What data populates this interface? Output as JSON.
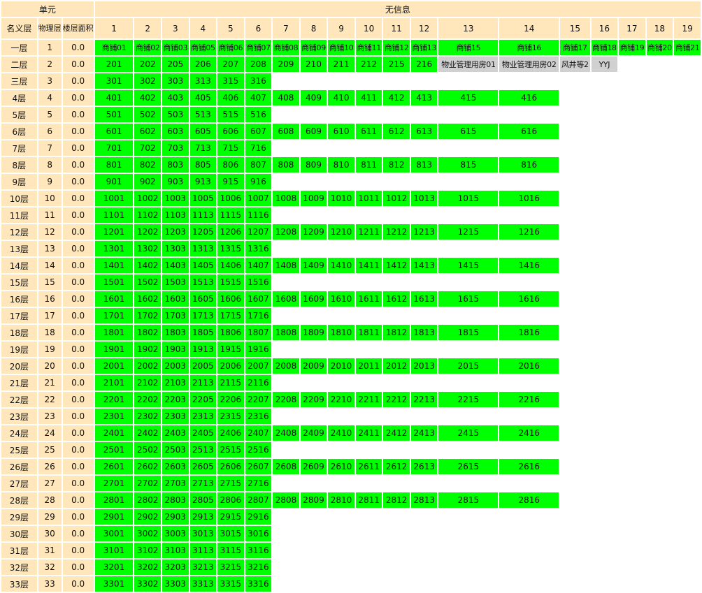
{
  "header": {
    "unit_label": "单元",
    "info_label": "无信息",
    "col_nominal": "名义层",
    "col_physical": "物理层",
    "col_area": "楼层面积",
    "columns": [
      "1",
      "2",
      "3",
      "4",
      "5",
      "6",
      "7",
      "8",
      "9",
      "10",
      "11",
      "12",
      "13",
      "14",
      "15",
      "16",
      "17",
      "18",
      "19"
    ]
  },
  "colors": {
    "header_bg": "#ffe6bb",
    "sold_green": "#00ff00",
    "other_gray": "#d0d0d0"
  },
  "floors": [
    {
      "name": "一层",
      "phys": "1",
      "area": "0.0",
      "rooms": [
        "商铺01",
        "商铺02",
        "商铺03",
        "商铺05",
        "商铺06",
        "商铺07",
        "商铺08",
        "商铺09",
        "商铺10",
        "商铺11",
        "商铺12",
        "商铺13",
        "商铺15",
        "商铺16",
        "商铺17",
        "商铺18",
        "商铺19",
        "商铺20",
        "商铺21"
      ]
    },
    {
      "name": "二层",
      "phys": "2",
      "area": "0.0",
      "rooms": [
        "201",
        "202",
        "205",
        "206",
        "207",
        "208",
        "209",
        "210",
        "211",
        "212",
        "215",
        "216",
        "物业管理用房01",
        "物业管理用房02",
        "风井等2",
        "YYJ"
      ]
    },
    {
      "name": "三层",
      "phys": "3",
      "area": "0.0",
      "rooms": [
        "301",
        "302",
        "303",
        "313",
        "315",
        "316"
      ]
    },
    {
      "name": "4层",
      "phys": "4",
      "area": "0.0",
      "rooms": [
        "401",
        "402",
        "403",
        "405",
        "406",
        "407",
        "408",
        "409",
        "410",
        "411",
        "412",
        "413",
        "415",
        "416"
      ]
    },
    {
      "name": "5层",
      "phys": "5",
      "area": "0.0",
      "rooms": [
        "501",
        "502",
        "503",
        "513",
        "515",
        "516"
      ]
    },
    {
      "name": "6层",
      "phys": "6",
      "area": "0.0",
      "rooms": [
        "601",
        "602",
        "603",
        "605",
        "606",
        "607",
        "608",
        "609",
        "610",
        "611",
        "612",
        "613",
        "615",
        "616"
      ]
    },
    {
      "name": "7层",
      "phys": "7",
      "area": "0.0",
      "rooms": [
        "701",
        "702",
        "703",
        "713",
        "715",
        "716"
      ]
    },
    {
      "name": "8层",
      "phys": "8",
      "area": "0.0",
      "rooms": [
        "801",
        "802",
        "803",
        "805",
        "806",
        "807",
        "808",
        "809",
        "810",
        "811",
        "812",
        "813",
        "815",
        "816"
      ]
    },
    {
      "name": "9层",
      "phys": "9",
      "area": "0.0",
      "rooms": [
        "901",
        "902",
        "903",
        "913",
        "915",
        "916"
      ]
    },
    {
      "name": "10层",
      "phys": "10",
      "area": "0.0",
      "rooms": [
        "1001",
        "1002",
        "1003",
        "1005",
        "1006",
        "1007",
        "1008",
        "1009",
        "1010",
        "1011",
        "1012",
        "1013",
        "1015",
        "1016"
      ]
    },
    {
      "name": "11层",
      "phys": "11",
      "area": "0.0",
      "rooms": [
        "1101",
        "1102",
        "1103",
        "1113",
        "1115",
        "1116"
      ]
    },
    {
      "name": "12层",
      "phys": "12",
      "area": "0.0",
      "rooms": [
        "1201",
        "1202",
        "1203",
        "1205",
        "1206",
        "1207",
        "1208",
        "1209",
        "1210",
        "1211",
        "1212",
        "1213",
        "1215",
        "1216"
      ]
    },
    {
      "name": "13层",
      "phys": "13",
      "area": "0.0",
      "rooms": [
        "1301",
        "1302",
        "1303",
        "1313",
        "1315",
        "1316"
      ]
    },
    {
      "name": "14层",
      "phys": "14",
      "area": "0.0",
      "rooms": [
        "1401",
        "1402",
        "1403",
        "1405",
        "1406",
        "1407",
        "1408",
        "1409",
        "1410",
        "1411",
        "1412",
        "1413",
        "1415",
        "1416"
      ]
    },
    {
      "name": "15层",
      "phys": "15",
      "area": "0.0",
      "rooms": [
        "1501",
        "1502",
        "1503",
        "1513",
        "1515",
        "1516"
      ]
    },
    {
      "name": "16层",
      "phys": "16",
      "area": "0.0",
      "rooms": [
        "1601",
        "1602",
        "1603",
        "1605",
        "1606",
        "1607",
        "1608",
        "1609",
        "1610",
        "1611",
        "1612",
        "1613",
        "1615",
        "1616"
      ]
    },
    {
      "name": "17层",
      "phys": "17",
      "area": "0.0",
      "rooms": [
        "1701",
        "1702",
        "1703",
        "1713",
        "1715",
        "1716"
      ]
    },
    {
      "name": "18层",
      "phys": "18",
      "area": "0.0",
      "rooms": [
        "1801",
        "1802",
        "1803",
        "1805",
        "1806",
        "1807",
        "1808",
        "1809",
        "1810",
        "1811",
        "1812",
        "1813",
        "1815",
        "1816"
      ]
    },
    {
      "name": "19层",
      "phys": "19",
      "area": "0.0",
      "rooms": [
        "1901",
        "1902",
        "1903",
        "1913",
        "1915",
        "1916"
      ]
    },
    {
      "name": "20层",
      "phys": "20",
      "area": "0.0",
      "rooms": [
        "2001",
        "2002",
        "2003",
        "2005",
        "2006",
        "2007",
        "2008",
        "2009",
        "2010",
        "2011",
        "2012",
        "2013",
        "2015",
        "2016"
      ]
    },
    {
      "name": "21层",
      "phys": "21",
      "area": "0.0",
      "rooms": [
        "2101",
        "2102",
        "2103",
        "2113",
        "2115",
        "2116"
      ]
    },
    {
      "name": "22层",
      "phys": "22",
      "area": "0.0",
      "rooms": [
        "2201",
        "2202",
        "2203",
        "2205",
        "2206",
        "2207",
        "2208",
        "2209",
        "2210",
        "2211",
        "2212",
        "2213",
        "2215",
        "2216"
      ]
    },
    {
      "name": "23层",
      "phys": "23",
      "area": "0.0",
      "rooms": [
        "2301",
        "2302",
        "2303",
        "2313",
        "2315",
        "2316"
      ]
    },
    {
      "name": "24层",
      "phys": "24",
      "area": "0.0",
      "rooms": [
        "2401",
        "2402",
        "2403",
        "2405",
        "2406",
        "2407",
        "2408",
        "2409",
        "2410",
        "2411",
        "2412",
        "2413",
        "2415",
        "2416"
      ]
    },
    {
      "name": "25层",
      "phys": "25",
      "area": "0.0",
      "rooms": [
        "2501",
        "2502",
        "2503",
        "2513",
        "2515",
        "2516"
      ]
    },
    {
      "name": "26层",
      "phys": "26",
      "area": "0.0",
      "rooms": [
        "2601",
        "2602",
        "2603",
        "2605",
        "2606",
        "2607",
        "2608",
        "2609",
        "2610",
        "2611",
        "2612",
        "2613",
        "2615",
        "2616"
      ]
    },
    {
      "name": "27层",
      "phys": "27",
      "area": "0.0",
      "rooms": [
        "2701",
        "2702",
        "2703",
        "2713",
        "2715",
        "2716"
      ]
    },
    {
      "name": "28层",
      "phys": "28",
      "area": "0.0",
      "rooms": [
        "2801",
        "2802",
        "2803",
        "2805",
        "2806",
        "2807",
        "2808",
        "2809",
        "2810",
        "2811",
        "2812",
        "2813",
        "2815",
        "2816"
      ]
    },
    {
      "name": "29层",
      "phys": "29",
      "area": "0.0",
      "rooms": [
        "2901",
        "2902",
        "2903",
        "2913",
        "2915",
        "2916"
      ]
    },
    {
      "name": "30层",
      "phys": "30",
      "area": "0.0",
      "rooms": [
        "3001",
        "3002",
        "3003",
        "3013",
        "3015",
        "3016"
      ]
    },
    {
      "name": "31层",
      "phys": "31",
      "area": "0.0",
      "rooms": [
        "3101",
        "3102",
        "3103",
        "3113",
        "3115",
        "3116"
      ]
    },
    {
      "name": "32层",
      "phys": "32",
      "area": "0.0",
      "rooms": [
        "3201",
        "3202",
        "3203",
        "3213",
        "3215",
        "3216"
      ]
    },
    {
      "name": "33层",
      "phys": "33",
      "area": "0.0",
      "rooms": [
        "3301",
        "3302",
        "3303",
        "3313",
        "3315",
        "3316"
      ]
    }
  ]
}
